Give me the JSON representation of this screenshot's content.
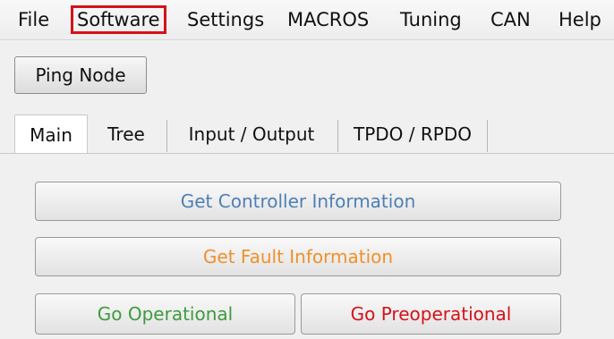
{
  "menubar": {
    "items": [
      {
        "label": "File"
      },
      {
        "label": "Software",
        "highlighted": true
      },
      {
        "label": "Settings"
      },
      {
        "label": "MACROS"
      },
      {
        "label": "Tuning"
      },
      {
        "label": "CAN"
      },
      {
        "label": "Help"
      }
    ],
    "highlight_color": "#d4121a"
  },
  "toolbar": {
    "ping_label": "Ping Node"
  },
  "tabs": [
    {
      "label": "Main",
      "active": true
    },
    {
      "label": "Tree"
    },
    {
      "label": "Input / Output"
    },
    {
      "label": "TPDO / RPDO"
    }
  ],
  "main": {
    "get_controller_info_label": "Get Controller Information",
    "get_fault_info_label": "Get Fault Information",
    "go_operational_label": "Go Operational",
    "go_preoperational_label": "Go Preoperational"
  },
  "colors": {
    "controller_info_text": "#4f7fb3",
    "fault_info_text": "#f0902a",
    "operational_text": "#3f9a3f",
    "preoperational_text": "#d4121a"
  }
}
